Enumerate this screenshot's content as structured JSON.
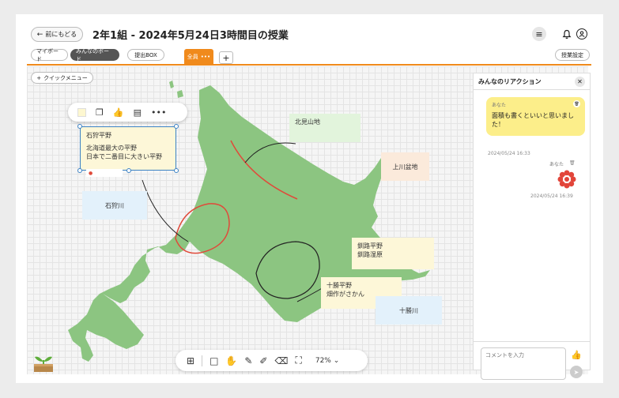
{
  "header": {
    "back_label": "前にもどる",
    "title": "2年1組 - 2024年5月24日3時間目の授業"
  },
  "tabs": {
    "myboard": "マイボード",
    "everyone": "みんなのボード",
    "submit": "提出BOX",
    "all": "全員",
    "settings": "授業設定"
  },
  "board": {
    "quick_menu": "クイックメニュー",
    "selected_note": {
      "title": "石狩平野",
      "line1": "北海道最大の平野",
      "line2": "日本で二番目に大きい平野"
    },
    "notes": {
      "ishikari_river": "石狩川",
      "kitami": "北見山地",
      "kamikawa": "上川盆地",
      "kushiro_1": "釧路平野",
      "kushiro_2": "釧路湿原",
      "tokachi_1": "十勝平野",
      "tokachi_2": "畑作がさかん",
      "tokachi_river": "十勝川"
    },
    "zoom": "72%",
    "colors": {
      "land": "#8cc581",
      "red_stroke": "#e04a3a",
      "black_stroke": "#222222"
    }
  },
  "panel": {
    "title": "みんなのリアクション",
    "reaction1": {
      "author": "あなた",
      "text": "面積も書くといいと思いました！",
      "time": "2024/05/24 16:33"
    },
    "reaction2": {
      "author": "あなた",
      "time": "2024/05/24 16:39"
    },
    "comment_placeholder": "コメントを入力"
  }
}
